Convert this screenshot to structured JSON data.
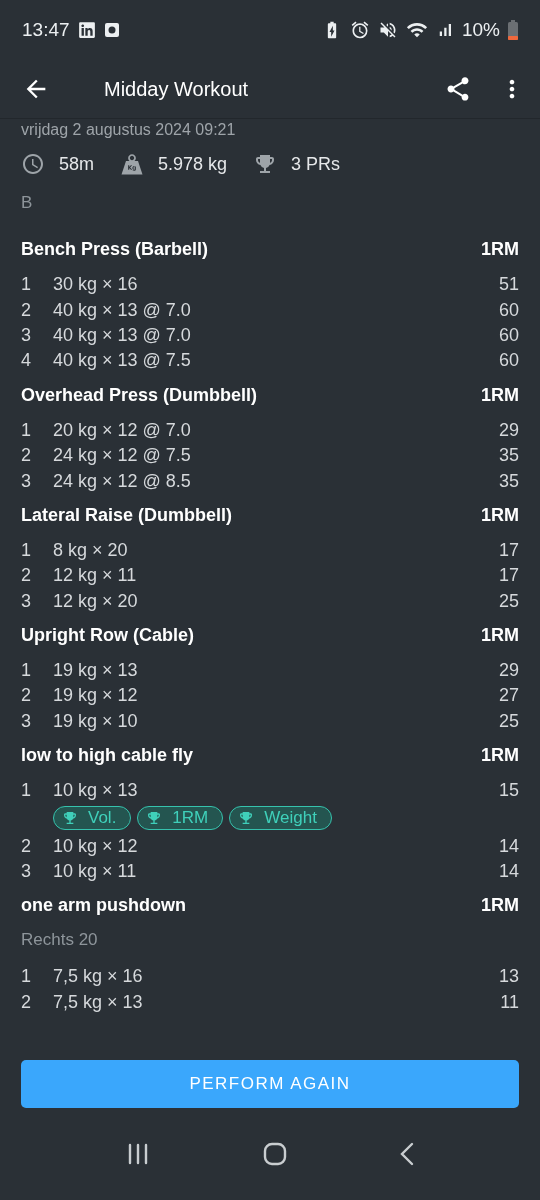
{
  "status_bar": {
    "time": "13:47",
    "battery": "10%"
  },
  "app_bar": {
    "title": "Midday Workout"
  },
  "date": "vrijdag 2 augustus 2024 09:21",
  "stats": [
    {
      "kind": "duration",
      "text": "58m"
    },
    {
      "kind": "volume",
      "text": "5.978 kg"
    },
    {
      "kind": "prs",
      "text": "3 PRs"
    }
  ],
  "note": "B",
  "exercises": [
    {
      "name": "Bench Press (Barbell)",
      "metric": "1RM",
      "sets": [
        {
          "index": "1",
          "set": "30 kg × 16",
          "value": "51"
        },
        {
          "index": "2",
          "set": "40 kg × 13 @ 7.0",
          "value": "60"
        },
        {
          "index": "3",
          "set": "40 kg × 13 @ 7.0",
          "value": "60"
        },
        {
          "index": "4",
          "set": "40 kg × 13 @ 7.5",
          "value": "60"
        }
      ]
    },
    {
      "name": "Overhead Press (Dumbbell)",
      "metric": "1RM",
      "sets": [
        {
          "index": "1",
          "set": "20 kg × 12 @ 7.0",
          "value": "29"
        },
        {
          "index": "2",
          "set": "24 kg × 12 @ 7.5",
          "value": "35"
        },
        {
          "index": "3",
          "set": "24 kg × 12 @ 8.5",
          "value": "35"
        }
      ]
    },
    {
      "name": "Lateral Raise (Dumbbell)",
      "metric": "1RM",
      "sets": [
        {
          "index": "1",
          "set": "8 kg × 20",
          "value": "17"
        },
        {
          "index": "2",
          "set": "12 kg × 11",
          "value": "17"
        },
        {
          "index": "3",
          "set": "12 kg × 20",
          "value": "25"
        }
      ]
    },
    {
      "name": "Upright Row (Cable)",
      "metric": "1RM",
      "sets": [
        {
          "index": "1",
          "set": "19 kg × 13",
          "value": "29"
        },
        {
          "index": "2",
          "set": "19 kg × 12",
          "value": "27"
        },
        {
          "index": "3",
          "set": "19 kg × 10",
          "value": "25"
        }
      ]
    },
    {
      "name": "low to high cable fly",
      "metric": "1RM",
      "sets": [
        {
          "index": "1",
          "set": "10 kg × 13",
          "value": "15",
          "badges": [
            "Vol.",
            "1RM",
            "Weight"
          ]
        },
        {
          "index": "2",
          "set": "10 kg × 12",
          "value": "14"
        },
        {
          "index": "3",
          "set": "10 kg × 11",
          "value": "14"
        }
      ]
    },
    {
      "name": "one arm pushdown",
      "metric": "1RM",
      "note": "Rechts 20",
      "sets": [
        {
          "index": "1",
          "set": "7,5 kg × 16",
          "value": "13"
        },
        {
          "index": "2",
          "set": "7,5 kg × 13",
          "value": "11"
        }
      ]
    }
  ],
  "button": "PERFORM AGAIN"
}
